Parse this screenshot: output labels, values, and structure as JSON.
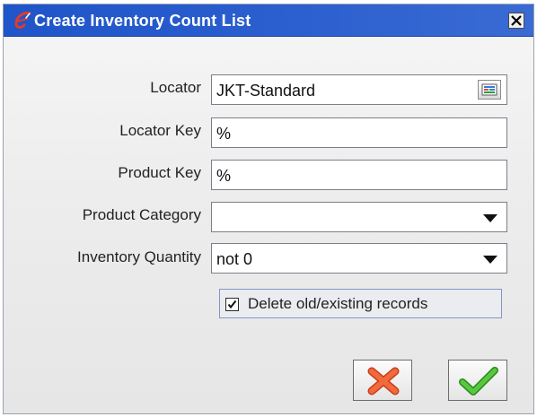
{
  "window": {
    "title": "Create Inventory Count List",
    "app_icon": "adempiere-logo-icon",
    "close_icon": "close-icon"
  },
  "form": {
    "locator": {
      "label": "Locator",
      "value": "JKT-Standard",
      "button_icon": "lookup-icon"
    },
    "locator_key": {
      "label": "Locator Key",
      "value": "%"
    },
    "product_key": {
      "label": "Product Key",
      "value": "%"
    },
    "product_category": {
      "label": "Product Category",
      "value": ""
    },
    "inventory_quantity": {
      "label": "Inventory Quantity",
      "value": "not 0"
    },
    "delete_old": {
      "label": "Delete old/existing records",
      "checked": true
    }
  },
  "buttons": {
    "cancel_icon": "cancel-x-icon",
    "ok_icon": "ok-checkmark-icon"
  },
  "colors": {
    "titlebar": "#2c5fcf",
    "cancel": "#e8552a",
    "ok": "#3fae2a"
  }
}
